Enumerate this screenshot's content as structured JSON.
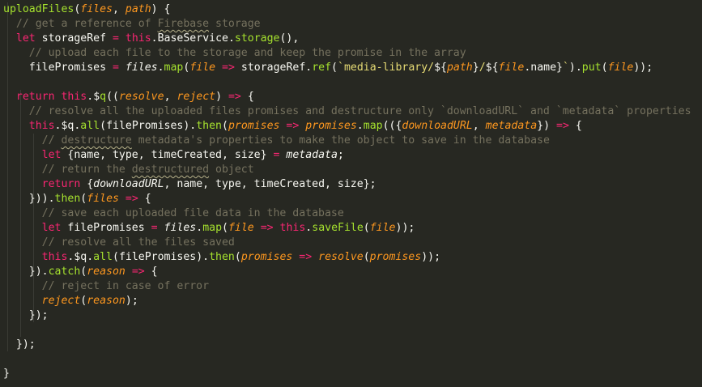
{
  "editor": {
    "theme": "monokai",
    "colors": {
      "background": "#272822",
      "text": "#f8f8f2",
      "keyword": "#f92672",
      "function": "#a6e22e",
      "parameter": "#fd971f",
      "comment": "#75715e",
      "string": "#e6db74"
    },
    "lines": [
      [
        [
          "fn",
          "uploadFiles"
        ],
        [
          "tx",
          "("
        ],
        [
          "pa",
          "files"
        ],
        [
          "tx",
          ", "
        ],
        [
          "pa",
          "path"
        ],
        [
          "tx",
          ") {"
        ]
      ],
      [
        [
          "cm",
          "  // get a reference of "
        ],
        [
          "cms",
          "Firebase"
        ],
        [
          "cm",
          " storage"
        ]
      ],
      [
        [
          "tx",
          "  "
        ],
        [
          "kw",
          "let"
        ],
        [
          "tx",
          " storageRef "
        ],
        [
          "kw",
          "="
        ],
        [
          "tx",
          " "
        ],
        [
          "kw",
          "this"
        ],
        [
          "tx",
          ".BaseService."
        ],
        [
          "fn",
          "storage"
        ],
        [
          "tx",
          "(),"
        ]
      ],
      [
        [
          "cm",
          "    // upload each file to the storage and keep the promise in the array"
        ]
      ],
      [
        [
          "tx",
          "    filePromises "
        ],
        [
          "kw",
          "="
        ],
        [
          "tx",
          " "
        ],
        [
          "it",
          "files"
        ],
        [
          "tx",
          "."
        ],
        [
          "fn",
          "map"
        ],
        [
          "tx",
          "("
        ],
        [
          "pa",
          "file"
        ],
        [
          "tx",
          " "
        ],
        [
          "kw",
          "=>"
        ],
        [
          "tx",
          " storageRef."
        ],
        [
          "fn",
          "ref"
        ],
        [
          "tx",
          "("
        ],
        [
          "st",
          "`media-library/"
        ],
        [
          "tx",
          "${"
        ],
        [
          "pa",
          "path"
        ],
        [
          "tx",
          "}"
        ],
        [
          "st",
          "/"
        ],
        [
          "tx",
          "${"
        ],
        [
          "pa",
          "file"
        ],
        [
          "tx",
          ".name}"
        ],
        [
          "st",
          "`"
        ],
        [
          "tx",
          ")."
        ],
        [
          "fn",
          "put"
        ],
        [
          "tx",
          "("
        ],
        [
          "pa",
          "file"
        ],
        [
          "tx",
          "));"
        ]
      ],
      [],
      [
        [
          "tx",
          "  "
        ],
        [
          "kw",
          "return"
        ],
        [
          "tx",
          " "
        ],
        [
          "kw",
          "this"
        ],
        [
          "tx",
          ".$"
        ],
        [
          "fn",
          "q"
        ],
        [
          "tx",
          "(("
        ],
        [
          "pa",
          "resolve"
        ],
        [
          "tx",
          ", "
        ],
        [
          "pa",
          "reject"
        ],
        [
          "tx",
          ") "
        ],
        [
          "kw",
          "=>"
        ],
        [
          "tx",
          " {"
        ]
      ],
      [
        [
          "cm",
          "    // resolve all the uploaded files promises and destructure only `downloadURL` and `metadata` properties"
        ]
      ],
      [
        [
          "tx",
          "    "
        ],
        [
          "kw",
          "this"
        ],
        [
          "tx",
          ".$q."
        ],
        [
          "fn",
          "all"
        ],
        [
          "tx",
          "(filePromises)."
        ],
        [
          "fn",
          "then"
        ],
        [
          "tx",
          "("
        ],
        [
          "pa",
          "promises"
        ],
        [
          "tx",
          " "
        ],
        [
          "kw",
          "=>"
        ],
        [
          "tx",
          " "
        ],
        [
          "pa",
          "promises"
        ],
        [
          "tx",
          "."
        ],
        [
          "fn",
          "map"
        ],
        [
          "tx",
          "(({"
        ],
        [
          "pa",
          "downloadURL"
        ],
        [
          "tx",
          ", "
        ],
        [
          "pa",
          "metadata"
        ],
        [
          "tx",
          "}) "
        ],
        [
          "kw",
          "=>"
        ],
        [
          "tx",
          " {"
        ]
      ],
      [
        [
          "cm",
          "      // "
        ],
        [
          "cms",
          "destructure"
        ],
        [
          "cm",
          " metadata's properties to make the object to save in the database"
        ]
      ],
      [
        [
          "tx",
          "      "
        ],
        [
          "kw",
          "let"
        ],
        [
          "tx",
          " {name, type, timeCreated, size} "
        ],
        [
          "kw",
          "="
        ],
        [
          "tx",
          " "
        ],
        [
          "it",
          "metadata"
        ],
        [
          "tx",
          ";"
        ]
      ],
      [
        [
          "cm",
          "      // return the "
        ],
        [
          "cms",
          "destructured"
        ],
        [
          "cm",
          " object"
        ]
      ],
      [
        [
          "tx",
          "      "
        ],
        [
          "kw",
          "return"
        ],
        [
          "tx",
          " {"
        ],
        [
          "it",
          "downloadURL"
        ],
        [
          "tx",
          ", name, type, timeCreated, size};"
        ]
      ],
      [
        [
          "tx",
          "    }))."
        ],
        [
          "fn",
          "then"
        ],
        [
          "tx",
          "("
        ],
        [
          "pa",
          "files"
        ],
        [
          "tx",
          " "
        ],
        [
          "kw",
          "=>"
        ],
        [
          "tx",
          " {"
        ]
      ],
      [
        [
          "cm",
          "      // save each uploaded file data in the database"
        ]
      ],
      [
        [
          "tx",
          "      "
        ],
        [
          "kw",
          "let"
        ],
        [
          "tx",
          " filePromises "
        ],
        [
          "kw",
          "="
        ],
        [
          "tx",
          " "
        ],
        [
          "it",
          "files"
        ],
        [
          "tx",
          "."
        ],
        [
          "fn",
          "map"
        ],
        [
          "tx",
          "("
        ],
        [
          "pa",
          "file"
        ],
        [
          "tx",
          " "
        ],
        [
          "kw",
          "=>"
        ],
        [
          "tx",
          " "
        ],
        [
          "kw",
          "this"
        ],
        [
          "tx",
          "."
        ],
        [
          "fn",
          "saveFile"
        ],
        [
          "tx",
          "("
        ],
        [
          "pa",
          "file"
        ],
        [
          "tx",
          "));"
        ]
      ],
      [
        [
          "cm",
          "      // resolve all the files saved"
        ]
      ],
      [
        [
          "tx",
          "      "
        ],
        [
          "kw",
          "this"
        ],
        [
          "tx",
          ".$q."
        ],
        [
          "fn",
          "all"
        ],
        [
          "tx",
          "(filePromises)."
        ],
        [
          "fn",
          "then"
        ],
        [
          "tx",
          "("
        ],
        [
          "pa",
          "promises"
        ],
        [
          "tx",
          " "
        ],
        [
          "kw",
          "=>"
        ],
        [
          "tx",
          " "
        ],
        [
          "pa",
          "resolve"
        ],
        [
          "tx",
          "("
        ],
        [
          "pa",
          "promises"
        ],
        [
          "tx",
          "));"
        ]
      ],
      [
        [
          "tx",
          "    })."
        ],
        [
          "fn",
          "catch"
        ],
        [
          "tx",
          "("
        ],
        [
          "pa",
          "reason"
        ],
        [
          "tx",
          " "
        ],
        [
          "kw",
          "=>"
        ],
        [
          "tx",
          " {"
        ]
      ],
      [
        [
          "cm",
          "      // reject in case of error"
        ]
      ],
      [
        [
          "tx",
          "      "
        ],
        [
          "pa",
          "reject"
        ],
        [
          "tx",
          "("
        ],
        [
          "pa",
          "reason"
        ],
        [
          "tx",
          ");"
        ]
      ],
      [
        [
          "tx",
          "    });"
        ]
      ],
      [],
      [
        [
          "tx",
          "  });"
        ]
      ],
      [],
      [
        [
          "tx",
          "}"
        ]
      ]
    ]
  }
}
